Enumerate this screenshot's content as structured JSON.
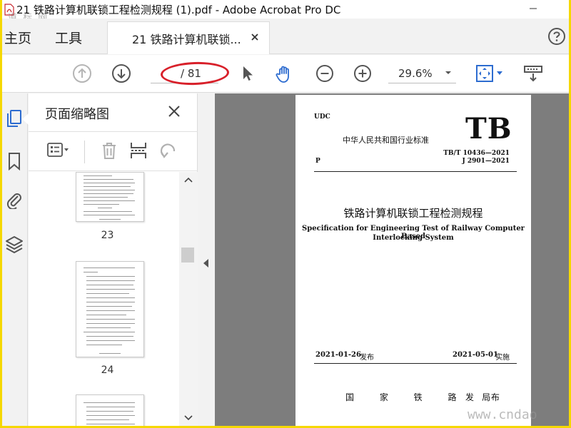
{
  "window": {
    "title": "21 铁路计算机联锁工程检测规程 (1).pdf - Adobe Acrobat Pro DC"
  },
  "menu": {
    "home": "主页",
    "tools": "工具"
  },
  "tab": {
    "label": "21 铁路计算机联锁..."
  },
  "toolbar": {
    "page_current": "",
    "page_total": "/ 81",
    "zoom": "29.6%",
    "icons": [
      "up-arrow-icon",
      "down-arrow-icon",
      "pointer-icon",
      "hand-icon",
      "zoom-out-icon",
      "zoom-in-icon",
      "fit-page-icon",
      "scroll-mode-icon"
    ]
  },
  "sidebar": {
    "title": "页面缩略图",
    "rail_icons": [
      "page-thumbnails-icon",
      "bookmark-icon",
      "attachment-icon",
      "layers-icon"
    ],
    "thumbnails": [
      {
        "label": "23"
      },
      {
        "label": "24"
      },
      {
        "label": ""
      }
    ]
  },
  "document": {
    "udc": "UDC",
    "standard_cn": "中华人民共和国行业标准",
    "tb": "TB",
    "p": "P",
    "code_tb": "TB/T 10436—2021",
    "code_j": "J 2901—2021",
    "title_cn": "铁路计算机联锁工程检测规程",
    "title_en_1": "Specification for Engineering Test of Railway Computer Based",
    "title_en_2": "Interlocking System",
    "issue_date": "2021-01-26",
    "issue_word": "发布",
    "impl_date": "2021-05-01",
    "impl_word": "实施",
    "publisher": "国 家 铁 路 局",
    "publish_word": "发 布"
  },
  "watermarks": {
    "top_left": "道 标 网",
    "bottom_right": "www.cndao"
  },
  "colors": {
    "highlight": "#d8202a",
    "accent": "#2d6cd0",
    "border": "#f5d800"
  }
}
